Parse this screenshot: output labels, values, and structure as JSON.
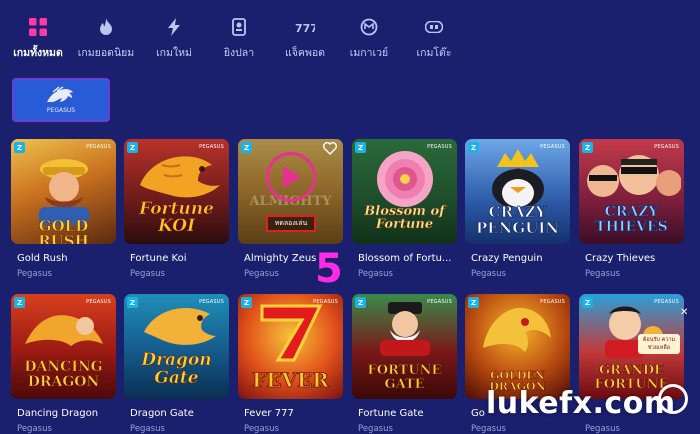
{
  "nav": {
    "items": [
      {
        "label": "เกมทั้งหมด",
        "icon": "grid-icon",
        "active": true
      },
      {
        "label": "เกมยอดนิยม",
        "icon": "flame-icon"
      },
      {
        "label": "เกมใหม่",
        "icon": "lightning-icon"
      },
      {
        "label": "ยิงปลา",
        "icon": "fishing-icon"
      },
      {
        "label": "แจ็คพอต",
        "icon": "slot-777-icon"
      },
      {
        "label": "เมกาเวย์",
        "icon": "megaways-icon"
      },
      {
        "label": "เกมโต๊ะ",
        "icon": "table-game-icon"
      }
    ]
  },
  "provider": {
    "name": "PEGASUS"
  },
  "games": [
    {
      "title": "Gold Rush",
      "provider": "Pegasus",
      "art": "GOLD RUSH"
    },
    {
      "title": "Fortune Koi",
      "provider": "Pegasus",
      "art": "Fortune KOI"
    },
    {
      "title": "Almighty Zeus",
      "provider": "Pegasus",
      "art": "ALMIGHTY"
    },
    {
      "title": "Blossom of Fortu...",
      "provider": "Pegasus",
      "art": "Blossom of Fortune"
    },
    {
      "title": "Crazy Penguin",
      "provider": "Pegasus",
      "art": "CRAZY PENGUIN"
    },
    {
      "title": "Crazy Thieves",
      "provider": "Pegasus",
      "art": "CRAZY THIEVES"
    },
    {
      "title": "Dancing Dragon",
      "provider": "Pegasus",
      "art": "DANCING DRAGON"
    },
    {
      "title": "Dragon Gate",
      "provider": "Pegasus",
      "art": "Dragon Gate"
    },
    {
      "title": "Fever 777",
      "provider": "Pegasus",
      "art": "FEVER"
    },
    {
      "title": "Fortune Gate",
      "provider": "Pegasus",
      "art": "FORTUNE GATE"
    },
    {
      "title": "Go",
      "provider": "Pegasus",
      "art": "GOLDEN DRAGON"
    },
    {
      "title": "",
      "provider": "Pegasus",
      "art": "GRANDE FORTUNE"
    }
  ],
  "hover": {
    "demo_label": "ทดลองเล่น"
  },
  "tag_letter": "Z",
  "thumb_logo": "PEGASUS",
  "thumb_sticker": "ต้อนรับ ความช่วยเหลือ",
  "marker": "5",
  "watermark": "lukefx.com",
  "colors": {
    "bg": "#1a1f6e",
    "accent": "#e7308f",
    "provider_bg": "#2a5bd7"
  }
}
